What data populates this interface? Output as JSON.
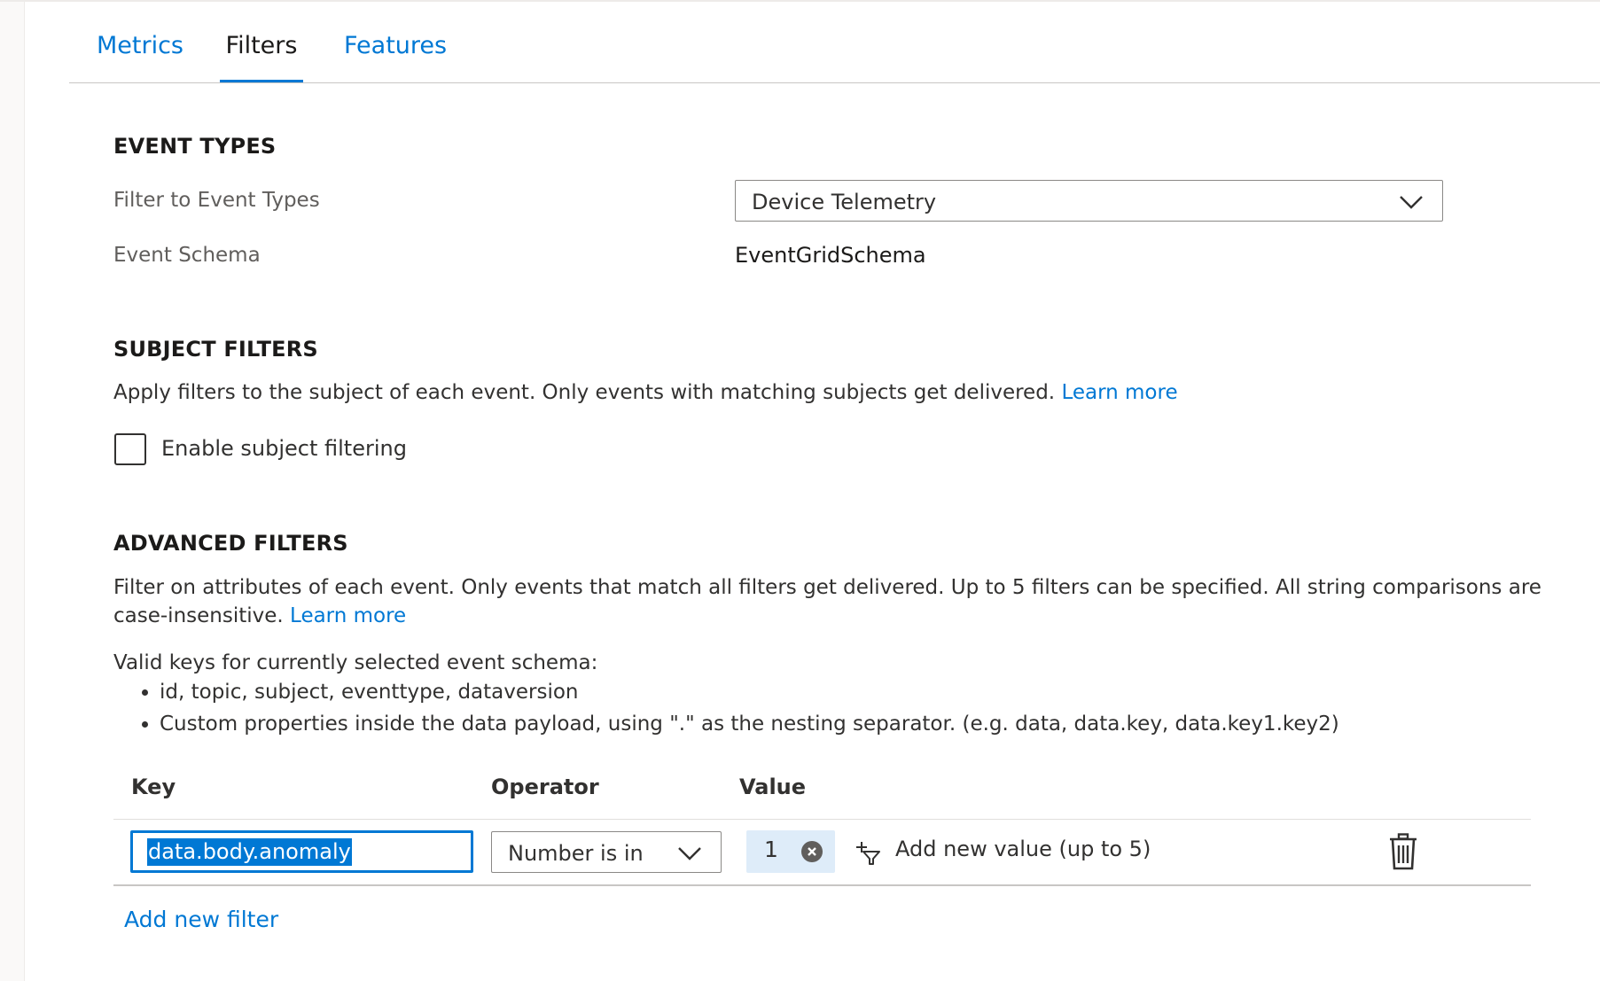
{
  "tabs": [
    {
      "label": "Metrics",
      "active": false
    },
    {
      "label": "Filters",
      "active": true
    },
    {
      "label": "Features",
      "active": false
    }
  ],
  "event_types": {
    "title": "EVENT TYPES",
    "filter_label": "Filter to Event Types",
    "filter_value": "Device Telemetry",
    "schema_label": "Event Schema",
    "schema_value": "EventGridSchema"
  },
  "subject_filters": {
    "title": "SUBJECT FILTERS",
    "description": "Apply filters to the subject of each event. Only events with matching subjects get delivered.",
    "learn_more": "Learn more",
    "checkbox_label": "Enable subject filtering",
    "checkbox_checked": false
  },
  "advanced_filters": {
    "title": "ADVANCED FILTERS",
    "description_line1": "Filter on attributes of each event. Only events that match all filters get delivered. Up to 5 filters can be specified. All string comparisons are",
    "description_line2": "case-insensitive.",
    "learn_more": "Learn more",
    "valid_keys_intro": "Valid keys for currently selected event schema:",
    "valid_keys": [
      "id, topic, subject, eventtype, dataversion",
      "Custom properties inside the data payload, using \".\" as the nesting separator. (e.g. data, data.key, data.key1.key2)"
    ],
    "columns": {
      "key": "Key",
      "operator": "Operator",
      "value": "Value"
    },
    "rows": [
      {
        "key": "data.body.anomaly",
        "operator": "Number is in",
        "values": [
          "1"
        ],
        "add_value_label": "Add new value (up to 5)"
      }
    ],
    "add_filter_label": "Add new filter"
  },
  "colors": {
    "accent": "#0078d4",
    "chip": "#deecf9",
    "text": "#323130",
    "muted": "#605e5c"
  }
}
